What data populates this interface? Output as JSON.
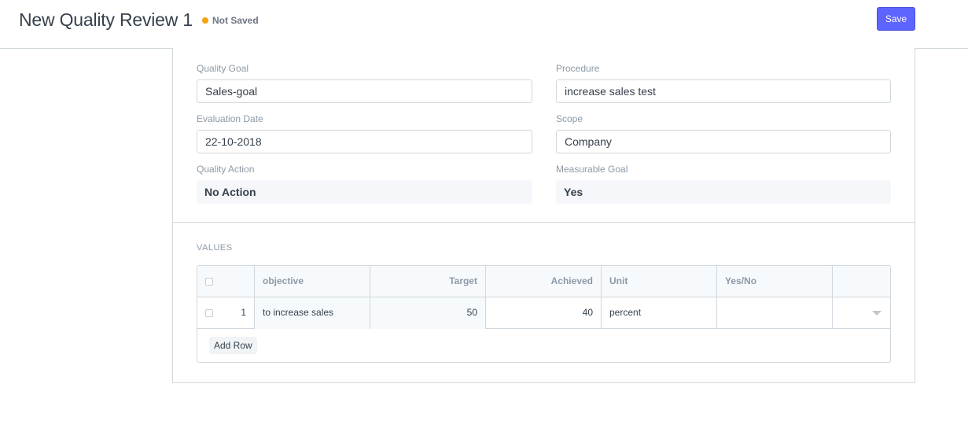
{
  "header": {
    "title": "New Quality Review 1",
    "status": "Not Saved",
    "status_color": "#f8a10b",
    "save_label": "Save",
    "accent_color": "#5e64ff"
  },
  "form": {
    "quality_goal": {
      "label": "Quality Goal",
      "value": "Sales-goal"
    },
    "procedure": {
      "label": "Procedure",
      "value": "increase sales test"
    },
    "evaluation_date": {
      "label": "Evaluation Date",
      "value": "22-10-2018"
    },
    "scope": {
      "label": "Scope",
      "value": "Company"
    },
    "quality_action": {
      "label": "Quality Action",
      "value": "No Action"
    },
    "measurable_goal": {
      "label": "Measurable Goal",
      "value": "Yes"
    }
  },
  "values": {
    "section_label": "VALUES",
    "columns": [
      "objective",
      "Target",
      "Achieved",
      "Unit",
      "Yes/No"
    ],
    "rows": [
      {
        "idx": "1",
        "objective": "to increase sales",
        "target": "50",
        "achieved": "40",
        "unit": "percent",
        "yes_no": ""
      }
    ],
    "add_row_label": "Add Row"
  }
}
